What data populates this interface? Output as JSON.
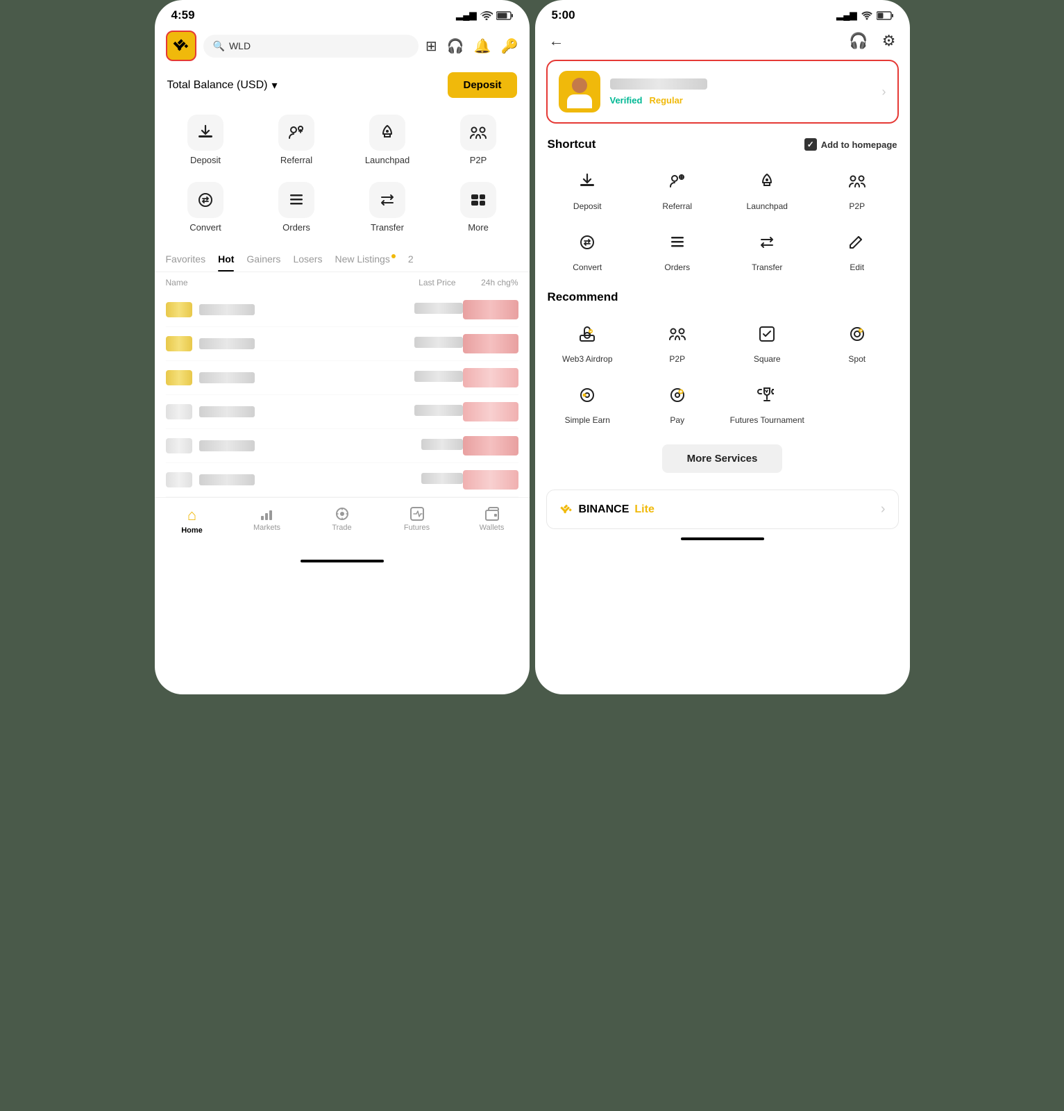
{
  "left": {
    "statusBar": {
      "time": "4:59",
      "locationIcon": "▶",
      "signal": "▂▄▆▇",
      "wifi": "WiFi",
      "battery": "🔋"
    },
    "header": {
      "searchPlaceholder": "WLD",
      "searchIcon": "🔍"
    },
    "balanceLabel": "Total Balance (USD)",
    "depositBtn": "Deposit",
    "quickActions": [
      {
        "id": "deposit",
        "label": "Deposit",
        "icon": "deposit"
      },
      {
        "id": "referral",
        "label": "Referral",
        "icon": "referral"
      },
      {
        "id": "launchpad",
        "label": "Launchpad",
        "icon": "launchpad"
      },
      {
        "id": "p2p",
        "label": "P2P",
        "icon": "p2p"
      },
      {
        "id": "convert",
        "label": "Convert",
        "icon": "convert"
      },
      {
        "id": "orders",
        "label": "Orders",
        "icon": "orders"
      },
      {
        "id": "transfer",
        "label": "Transfer",
        "icon": "transfer"
      },
      {
        "id": "more",
        "label": "More",
        "icon": "more"
      }
    ],
    "marketTabs": [
      "Favorites",
      "Hot",
      "Gainers",
      "Losers",
      "New Listings",
      "2"
    ],
    "activeTab": "Hot",
    "tableHeaders": {
      "name": "Name",
      "lastPrice": "Last Price",
      "change": "24h chg%"
    },
    "bottomNav": [
      {
        "id": "home",
        "label": "Home",
        "active": true
      },
      {
        "id": "markets",
        "label": "Markets",
        "active": false
      },
      {
        "id": "trade",
        "label": "Trade",
        "active": false
      },
      {
        "id": "futures",
        "label": "Futures",
        "active": false
      },
      {
        "id": "wallets",
        "label": "Wallets",
        "active": false
      }
    ]
  },
  "right": {
    "statusBar": {
      "time": "5:00",
      "locationIcon": "▶"
    },
    "profile": {
      "verified": "Verified",
      "tier": "Regular"
    },
    "shortcut": {
      "sectionTitle": "Shortcut",
      "addHomepage": "Add to homepage",
      "items": [
        {
          "id": "deposit",
          "label": "Deposit"
        },
        {
          "id": "referral",
          "label": "Referral"
        },
        {
          "id": "launchpad",
          "label": "Launchpad"
        },
        {
          "id": "p2p",
          "label": "P2P"
        },
        {
          "id": "convert",
          "label": "Convert"
        },
        {
          "id": "orders",
          "label": "Orders"
        },
        {
          "id": "transfer",
          "label": "Transfer"
        },
        {
          "id": "edit",
          "label": "Edit"
        }
      ]
    },
    "recommend": {
      "sectionTitle": "Recommend",
      "items": [
        {
          "id": "web3airdrop",
          "label": "Web3 Airdrop"
        },
        {
          "id": "p2p",
          "label": "P2P"
        },
        {
          "id": "square",
          "label": "Square"
        },
        {
          "id": "spot",
          "label": "Spot"
        },
        {
          "id": "simpleearn",
          "label": "Simple Earn"
        },
        {
          "id": "pay",
          "label": "Pay"
        },
        {
          "id": "futures-tournament",
          "label": "Futures Tournament"
        }
      ]
    },
    "moreServicesBtn": "More Services",
    "liteBanner": {
      "binance": "BINANCE",
      "lite": "Lite",
      "chevron": "›"
    }
  }
}
